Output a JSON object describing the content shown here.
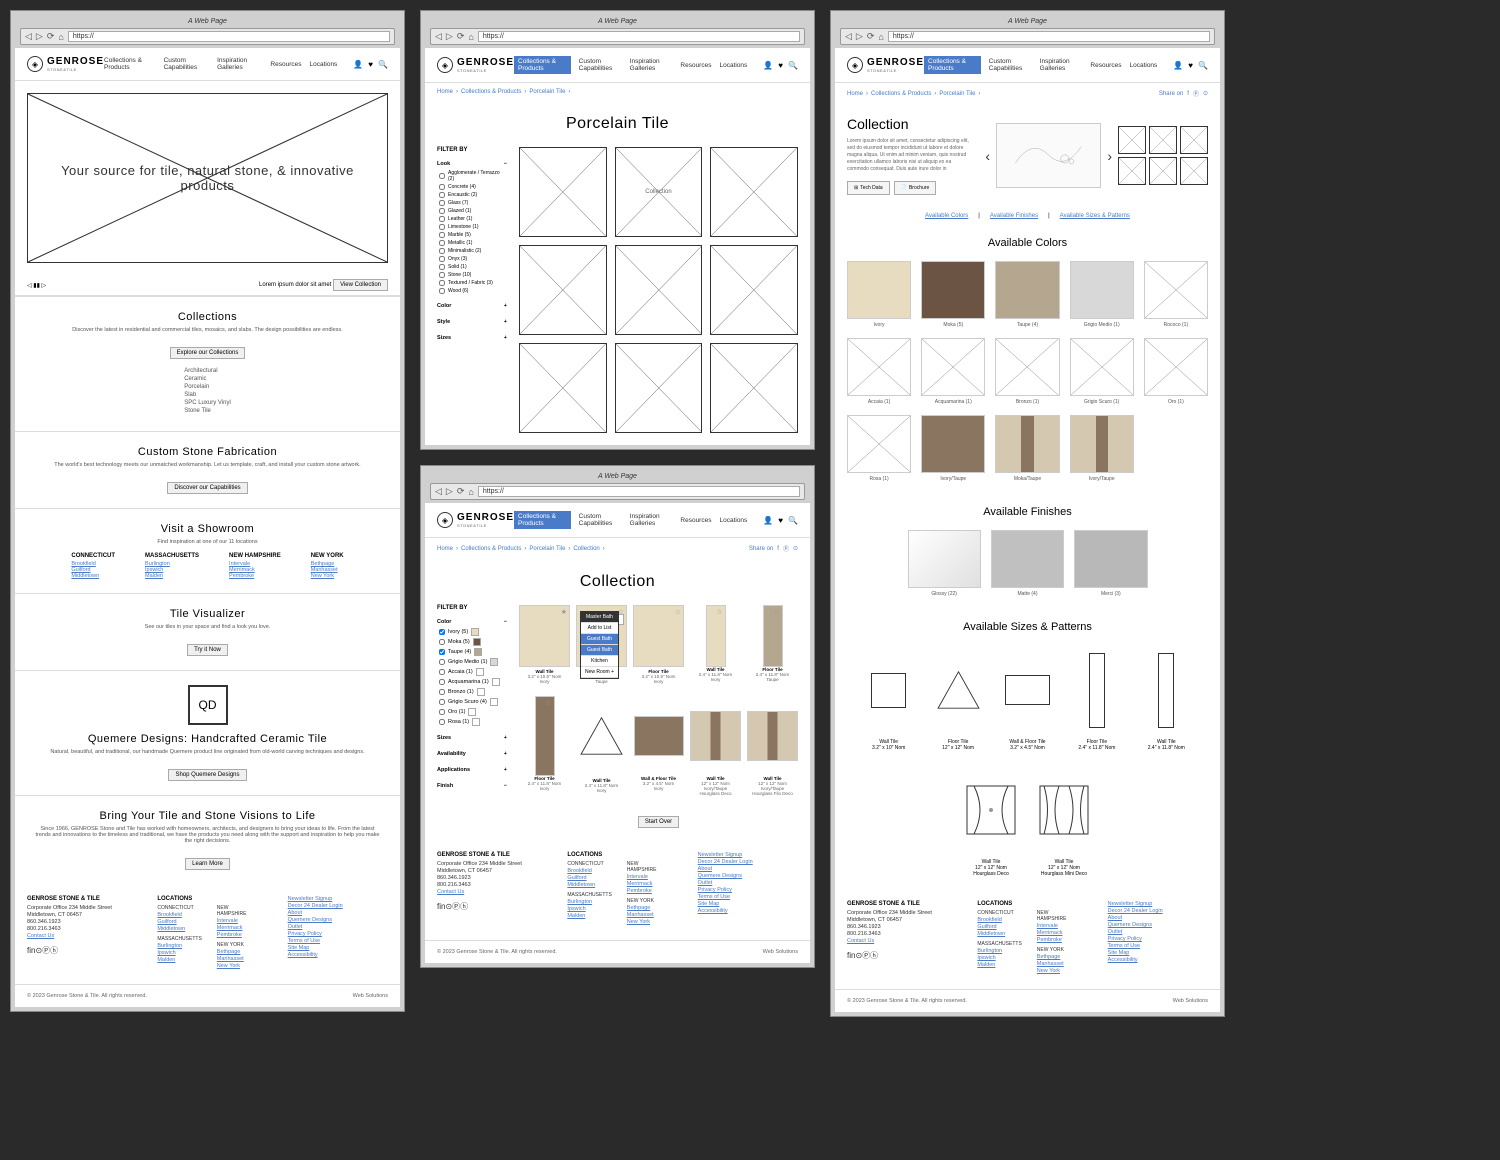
{
  "browser": {
    "title": "A Web Page",
    "url": "https://"
  },
  "brand": {
    "name": "GENROSE",
    "sub": "STONE&TILE"
  },
  "nav": {
    "items": [
      "Collections & Products",
      "Custom Capabilities",
      "Inspiration Galleries",
      "Resources",
      "Locations"
    ]
  },
  "home": {
    "hero": "Your source for tile, natural stone, & innovative products",
    "hero_sub": "Lorem ipsum dolor sit amet",
    "view_btn": "View Collection",
    "s1": {
      "title": "Collections",
      "desc": "Discover the latest in residential and commercial tiles, mosaics, and slabs. The design possibilities are endless.",
      "btn": "Explore our Collections",
      "list": [
        "Architectural",
        "Ceramic",
        "Porcelain",
        "Slab",
        "SPC Luxury Vinyl",
        "Stone Tile"
      ]
    },
    "s2": {
      "title": "Custom Stone Fabrication",
      "desc": "The world's best technology meets our unmatched workmanship. Let us template, craft, and install your custom stone artwork.",
      "btn": "Discover our Capabilities"
    },
    "s3": {
      "title": "Visit a Showroom",
      "desc": "Find inspiration at one of our 11 locations"
    },
    "s4": {
      "title": "Tile Visualizer",
      "desc": "See our tiles in your space and find a look you love.",
      "btn": "Try it Now"
    },
    "s5": {
      "title": "Quemere Designs: Handcrafted Ceramic Tile",
      "desc": "Natural, beautiful, and traditional, our handmade Quemere product line originated from old-world carving techniques and designs.",
      "btn": "Shop Quemere Designs"
    },
    "s6": {
      "title": "Bring Your Tile and Stone Visions to Life",
      "desc": "Since 1966, GENROSE Stone and Tile has worked with homeowners, architects, and designers to bring your ideas to life. From the latest trends and innovations to the timeless and traditional, we have the products you need along with the support and inspiration to help you make the right decisions.",
      "btn": "Learn More"
    }
  },
  "locations": {
    "ct": {
      "state": "CONNECTICUT",
      "cities": [
        "Brookfield",
        "Guilford",
        "Middletown"
      ]
    },
    "ma": {
      "state": "MASSACHUSETTS",
      "cities": [
        "Burlington",
        "Ipswich",
        "Malden"
      ]
    },
    "nh": {
      "state": "NEW HAMPSHIRE",
      "cities": [
        "Intervale",
        "Merrimack",
        "Pembroke"
      ]
    },
    "ny": {
      "state": "NEW YORK",
      "cities": [
        "Bethpage",
        "Manhasset",
        "New York"
      ]
    }
  },
  "footer": {
    "company": {
      "name": "GENROSE STONE & TILE",
      "addr": "Corporate Office 234 Middle Street",
      "city": "Middletown, CT 06457",
      "ph1": "860.346.1923",
      "ph2": "800.216.3463",
      "contact": "Contact Us"
    },
    "links": [
      "Newsletter Signup",
      "Decor 24 Dealer Login",
      "About",
      "Quemere Designs",
      "Outlet",
      "Privacy Policy",
      "Terms of Use",
      "Site Map",
      "Accessibility"
    ],
    "loc_title": "LOCATIONS",
    "copy": "© 2023 Genrose Stone & Tile. All rights reserved.",
    "web": "Web Solutions"
  },
  "listing": {
    "title": "Porcelain Tile",
    "bc": [
      "Home",
      "Collections & Products",
      "Porcelain Tile"
    ],
    "filter_title": "FILTER BY",
    "filters": {
      "look": {
        "label": "Look",
        "opts": [
          "Agglomerate / Terrazzo (2)",
          "Concrete (4)",
          "Encaustic (2)",
          "Glass (7)",
          "Glazed (1)",
          "Leather (1)",
          "Limestone (1)",
          "Marble (5)",
          "Metallic (1)",
          "Minimalistic (2)",
          "Onyx (3)",
          "Solid (1)",
          "Stone (10)",
          "Textured / Fabric (3)",
          "Wood (6)"
        ]
      },
      "color": "Color",
      "style": "Style",
      "sizes": "Sizes"
    },
    "tile_label": "Collection"
  },
  "detail": {
    "title": "Collection",
    "bc": [
      "Home",
      "Collections & Products",
      "Porcelain Tile",
      "Collection"
    ],
    "share": "Share on",
    "filter_title": "FILTER BY",
    "colors": [
      {
        "label": "Ivory (5)",
        "checked": true,
        "cls": "sw-ivory"
      },
      {
        "label": "Moka (5)",
        "checked": false,
        "cls": "sw-moka"
      },
      {
        "label": "Taupe (4)",
        "checked": true,
        "cls": "sw-taupe"
      },
      {
        "label": "Grigio Medio (1)",
        "checked": false,
        "cls": "sw-grey"
      },
      {
        "label": "Accaia (1)",
        "checked": false,
        "cls": ""
      },
      {
        "label": "Acquamarina (1)",
        "checked": false,
        "cls": ""
      },
      {
        "label": "Bronzo (1)",
        "checked": false,
        "cls": ""
      },
      {
        "label": "Grigio Scuro (4)",
        "checked": false,
        "cls": ""
      },
      {
        "label": "Oro (1)",
        "checked": false,
        "cls": ""
      },
      {
        "label": "Rosa (1)",
        "checked": false,
        "cls": ""
      }
    ],
    "groups": [
      "Sizes",
      "Availability",
      "Applications",
      "Finish"
    ],
    "popup": {
      "title": "Master Bath",
      "add": "Add to List",
      "opts": [
        "Guest Bath",
        "Guest Bath",
        "Kitchen",
        "New Room +"
      ]
    },
    "see_room": "See in your room",
    "products": [
      {
        "name": "Wall Tile",
        "spec": "3.2\" x 10.5\" Nom",
        "color": "Ivory"
      },
      {
        "name": "Floor Tile",
        "spec": "3.2\" x 10.5\" Nom",
        "color": "Taupe"
      },
      {
        "name": "Floor Tile",
        "spec": "3.2\" x 10.5\" Nom",
        "color": "Ivory"
      },
      {
        "name": "Wall Tile",
        "spec": "2.4\" x 11.8\" Nom",
        "color": "Ivory"
      },
      {
        "name": "Floor Tile",
        "spec": "2.4\" x 11.8\" Nom",
        "color": "Taupe"
      }
    ],
    "products2": [
      {
        "name": "Floor Tile",
        "spec": "2.4\" x 11.8\" Nom",
        "color": "Ivory"
      },
      {
        "name": "Wall Tile",
        "spec": "2.4\" x 11.8\" Nom",
        "color": "Ivory"
      },
      {
        "name": "Wall & Floor Tile",
        "spec": "3.2\" x 4.5\" Nom",
        "color": "Ivory"
      },
      {
        "name": "Wall Tile",
        "spec": "12\" x 12\" Nom",
        "color": "Ivory/Taupe",
        "sub": "Hourglass Deco"
      },
      {
        "name": "Wall Tile",
        "spec": "12\" x 12\" Nom",
        "color": "Ivory/Taupe",
        "sub": "Hourglass Filo Deco"
      }
    ],
    "start_over": "Start Over"
  },
  "coll_page": {
    "title": "Collection",
    "bc": [
      "Home",
      "Collections & Products",
      "Porcelain Tile"
    ],
    "desc": "Lorem ipsum dolor sit amet, consectetur adipiscing elit, sed do eiusmod tempor incididunt ut labore et dolore magna aliqua. Ut enim ad minim veniam, quis nostrud exercitation ullamco laboris nisi ut aliquip ex ea commodo consequat. Duis aute irure dolor in",
    "btn1": "Tech Data",
    "btn2": "Brochure",
    "tabs": [
      "Available Colors",
      "Available Finishes",
      "Available Sizes & Patterns"
    ],
    "colors_title": "Available Colors",
    "colors": [
      {
        "name": "Ivory",
        "cls": "sw-ivory"
      },
      {
        "name": "Moka (5)",
        "cls": "sw-moka"
      },
      {
        "name": "Taupe (4)",
        "cls": "sw-taupe"
      },
      {
        "name": "Grigio Medio (1)",
        "cls": "sw-grey"
      },
      {
        "name": "Rococo (1)",
        "cls": ""
      },
      {
        "name": "Accaia (1)",
        "cls": ""
      },
      {
        "name": "Acquamarina (1)",
        "cls": ""
      },
      {
        "name": "Bronzo (1)",
        "cls": ""
      },
      {
        "name": "Grigio Scuro (1)",
        "cls": ""
      },
      {
        "name": "Oro (1)",
        "cls": ""
      },
      {
        "name": "Rosa (1)",
        "cls": ""
      },
      {
        "name": "Ivory/Taupe",
        "cls": "sw-dark"
      },
      {
        "name": "Moka/Taupe",
        "cls": "sw-pattern"
      },
      {
        "name": "Ivory/Taupe",
        "cls": "sw-pattern"
      }
    ],
    "finishes_title": "Available Finishes",
    "finishes": [
      {
        "name": "Glossy (22)",
        "cls": "sw-glossy"
      },
      {
        "name": "Matte (4)",
        "cls": "sw-matte"
      },
      {
        "name": "Merci (3)",
        "cls": "sw-merci"
      }
    ],
    "sizes_title": "Available Sizes & Patterns",
    "sizes": [
      {
        "name": "Wall Tile",
        "spec": "3.2\" x 10\" Nom"
      },
      {
        "name": "Floor Tile",
        "spec": "12\" x 12\" Nom"
      },
      {
        "name": "Wall & Floor Tile",
        "spec": "3.2\" x 4.5\" Nom"
      },
      {
        "name": "Floor Tile",
        "spec": "2.4\" x 11.8\" Nom"
      },
      {
        "name": "Wall Tile",
        "spec": "2.4\" x 11.8\" Nom"
      }
    ],
    "decos": [
      {
        "name": "Wall Tile",
        "spec": "12\" x 12\" Nom",
        "sub": "Hourglass Deco"
      },
      {
        "name": "Wall Tile",
        "spec": "12\" x 12\" Nom",
        "sub": "Hourglass Mini Deco"
      }
    ]
  }
}
